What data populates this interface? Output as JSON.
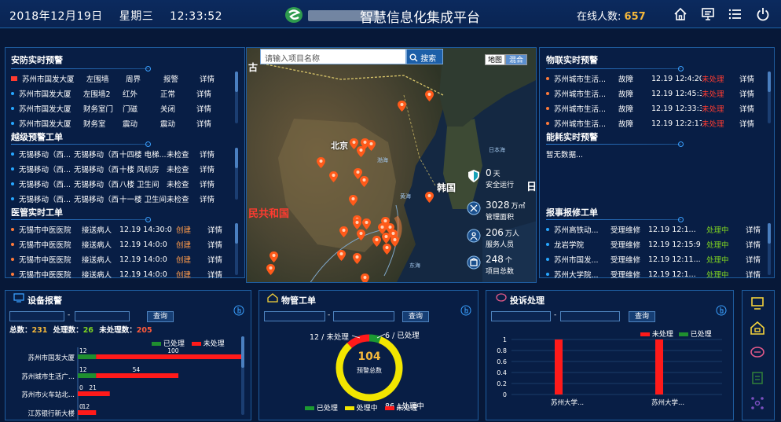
{
  "header": {
    "date": "2018年12月19日",
    "weekday": "星期三",
    "time": "12:33:52",
    "title": "智慧信息化集成平台",
    "online_label": "在线人数:",
    "online_count": "657"
  },
  "security": {
    "title": "安防实时预警",
    "rows": [
      {
        "site": "苏州市国发大厦",
        "loc": "左围墙",
        "type": "周界",
        "status": "报警",
        "action": "详情",
        "dot": "#ff4a3a"
      },
      {
        "site": "苏州市国发大厦",
        "loc": "左围墙2",
        "type": "红外",
        "status": "正常",
        "action": "详情",
        "dot": "#27a7ff"
      },
      {
        "site": "苏州市国发大厦",
        "loc": "财务室门",
        "type": "门磁",
        "status": "关闭",
        "action": "详情",
        "dot": "#27a7ff"
      },
      {
        "site": "苏州市国发大厦",
        "loc": "财务室",
        "type": "震动",
        "status": "震动",
        "action": "详情",
        "dot": "#27a7ff"
      }
    ]
  },
  "patrol": {
    "title": "越级预警工单",
    "rows": [
      {
        "site": "无锡移动（西...",
        "unit": "无锡移动（西...",
        "loc": "十四楼 电梯...",
        "status": "未检查",
        "action": "详情"
      },
      {
        "site": "无锡移动（西...",
        "unit": "无锡移动（西...",
        "loc": "十楼 风机房",
        "status": "未检查",
        "action": "详情"
      },
      {
        "site": "无锡移动（西...",
        "unit": "无锡移动（西...",
        "loc": "八楼 卫生间",
        "status": "未检查",
        "action": "详情"
      },
      {
        "site": "无锡移动（西...",
        "unit": "无锡移动（西...",
        "loc": "十一楼 卫生间",
        "status": "未检查",
        "action": "详情"
      }
    ]
  },
  "medical": {
    "title": "医管实时工单",
    "rows": [
      {
        "site": "无锡市中医医院",
        "type": "接送病人",
        "time": "12.19 14:30:0",
        "status": "创建",
        "action": "详情"
      },
      {
        "site": "无锡市中医医院",
        "type": "接送病人",
        "time": "12.19 14:0:0",
        "status": "创建",
        "action": "详情"
      },
      {
        "site": "无锡市中医医院",
        "type": "接送病人",
        "time": "12.19 14:0:0",
        "status": "创建",
        "action": "详情"
      },
      {
        "site": "无锡市中医医院",
        "type": "接送病人",
        "time": "12.19 14:0:0",
        "status": "创建",
        "action": "详情"
      }
    ]
  },
  "map": {
    "search_placeholder": "请输入项目名称",
    "search_btn": "搜索",
    "type_map": "地图",
    "type_hybrid": "混合",
    "labels": {
      "beijing": "北京",
      "korea": "韩国",
      "china": "民共和国",
      "gu": "古",
      "sea_japan": "日本海",
      "bohai": "渤海",
      "yellow_sea": "黄海",
      "east_sea": "东海",
      "ri": "日"
    },
    "stats": [
      {
        "value": "0",
        "unit": "天",
        "label": "安全运行"
      },
      {
        "value": "3028",
        "unit": "万㎡",
        "label": "管理面积"
      },
      {
        "value": "206",
        "unit": "万人",
        "label": "服务人员"
      },
      {
        "value": "248",
        "unit": "个",
        "label": "项目总数"
      }
    ]
  },
  "iot": {
    "title": "物联实时预警",
    "rows": [
      {
        "site": "苏州城市生活...",
        "type": "故障",
        "time": "12.19 12:4:20",
        "status": "未处理",
        "action": "详情"
      },
      {
        "site": "苏州城市生活...",
        "type": "故障",
        "time": "12.19 12:45:35",
        "status": "未处理",
        "action": "详情"
      },
      {
        "site": "苏州城市生活...",
        "type": "故障",
        "time": "12.19 12:33:33",
        "status": "未处理",
        "action": "详情"
      },
      {
        "site": "苏州城市生活...",
        "type": "故障",
        "time": "12.19 12:2:17",
        "status": "未处理",
        "action": "详情"
      }
    ]
  },
  "energy": {
    "title": "能耗实时预警",
    "empty": "暂无数据..."
  },
  "repair": {
    "title": "报事报修工单",
    "rows": [
      {
        "site": "苏州高铁动...",
        "type": "受理维修",
        "time": "12.19 12:1...",
        "status": "处理中",
        "action": "详情"
      },
      {
        "site": "龙岩学院",
        "type": "受理维修",
        "time": "12.19 12:15:9",
        "status": "处理中",
        "action": "详情"
      },
      {
        "site": "苏州市国发...",
        "type": "受理维修",
        "time": "12.19 12:11...",
        "status": "处理中",
        "action": "详情"
      },
      {
        "site": "苏州大学院...",
        "type": "受理维修",
        "time": "12.19 12:1...",
        "status": "处理中",
        "action": "详情"
      }
    ]
  },
  "device": {
    "title": "设备报警",
    "query": "查询",
    "total_label": "总数：",
    "total": "231",
    "done_label": "处理数：",
    "done": "26",
    "undone_label": "未处理数：",
    "undone": "205",
    "legend_done": "已处理",
    "legend_undone": "未处理"
  },
  "wuguan": {
    "title": "物管工单",
    "query": "查询",
    "undone_label": "12 / 未处理",
    "done_label": "6 / 已处理",
    "processing_label": "86 / 处理中",
    "total": "104",
    "total_label": "预警总数",
    "legend": [
      "已处理",
      "处理中",
      "未处理"
    ]
  },
  "complaint": {
    "title": "投诉处理",
    "query": "查询",
    "legend_undone": "未处理",
    "legend_done": "已处理"
  },
  "chart_data": [
    {
      "type": "bar",
      "orientation": "horizontal",
      "categories": [
        "苏州市国发大厦",
        "苏州城市生活广...",
        "苏州市火车站北...",
        "江苏银行新大楼"
      ],
      "series": [
        {
          "name": "已处理",
          "values": [
            12,
            12,
            0,
            0
          ],
          "color": "#1f8f2f"
        },
        {
          "name": "未处理",
          "values": [
            100,
            54,
            21,
            12
          ],
          "color": "#ff1a1a"
        }
      ]
    },
    {
      "type": "pie",
      "slices": [
        {
          "name": "已处理",
          "value": 6,
          "color": "#1c9a32"
        },
        {
          "name": "处理中",
          "value": 86,
          "color": "#f2e600"
        },
        {
          "name": "未处理",
          "value": 12,
          "color": "#ff1a1a"
        }
      ],
      "total": 104
    },
    {
      "type": "bar",
      "categories": [
        "苏州大学...",
        "苏州大学..."
      ],
      "yticks": [
        "0",
        "0.2",
        "0.4",
        "0.6",
        "0.8",
        "1"
      ],
      "ylim": [
        0,
        1
      ],
      "series": [
        {
          "name": "未处理",
          "values": [
            1,
            1
          ],
          "color": "#ff1a1a"
        },
        {
          "name": "已处理",
          "values": [
            0,
            0
          ],
          "color": "#1f8f2f"
        }
      ]
    }
  ]
}
